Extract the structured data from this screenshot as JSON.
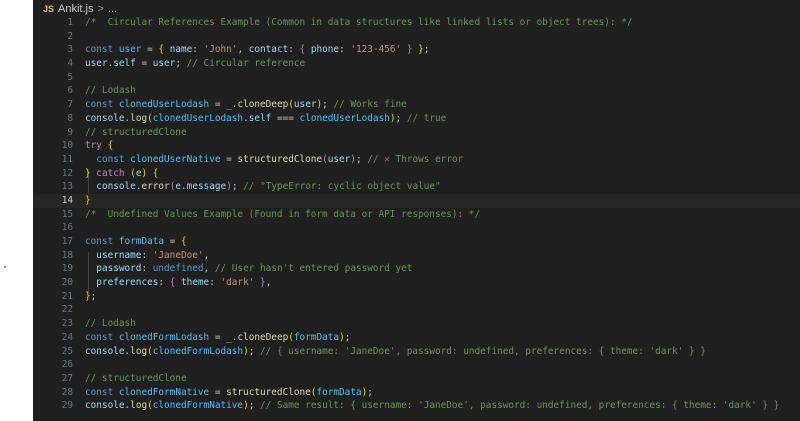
{
  "breadcrumb": {
    "badge": "JS",
    "file": "Ankit.js",
    "sep": ">",
    "rest": "..."
  },
  "lines": [
    {
      "n": "1",
      "t": [
        [
          "cmt",
          "/*  Circular References Example (Common in data structures like linked lists or object trees): */"
        ]
      ]
    },
    {
      "n": "2",
      "t": []
    },
    {
      "n": "3",
      "t": [
        [
          "kw",
          "const "
        ],
        [
          "var",
          "user"
        ],
        [
          "txt",
          " = "
        ],
        [
          "b1",
          "{ "
        ],
        [
          "prop",
          "name"
        ],
        [
          "txt",
          ": "
        ],
        [
          "str",
          "'John'"
        ],
        [
          "txt",
          ", "
        ],
        [
          "prop",
          "contact"
        ],
        [
          "txt",
          ": "
        ],
        [
          "b2",
          "{ "
        ],
        [
          "prop",
          "phone"
        ],
        [
          "txt",
          ": "
        ],
        [
          "str",
          "'123-456'"
        ],
        [
          "b2",
          " }"
        ],
        [
          "b1",
          " }"
        ],
        [
          "txt",
          ";"
        ]
      ]
    },
    {
      "n": "4",
      "t": [
        [
          "prop",
          "user"
        ],
        [
          "txt",
          "."
        ],
        [
          "prop",
          "self"
        ],
        [
          "txt",
          " = "
        ],
        [
          "prop",
          "user"
        ],
        [
          "txt",
          "; "
        ],
        [
          "cmt",
          "// Circular reference"
        ]
      ]
    },
    {
      "n": "5",
      "t": []
    },
    {
      "n": "6",
      "t": [
        [
          "cmt",
          "// Lodash"
        ]
      ]
    },
    {
      "n": "7",
      "t": [
        [
          "kw",
          "const "
        ],
        [
          "var",
          "clonedUserLodash"
        ],
        [
          "txt",
          " = "
        ],
        [
          "prop",
          "_"
        ],
        [
          "txt",
          "."
        ],
        [
          "fn",
          "cloneDeep"
        ],
        [
          "b1",
          "("
        ],
        [
          "prop",
          "user"
        ],
        [
          "b1",
          ")"
        ],
        [
          "txt",
          "; "
        ],
        [
          "cmt",
          "// Works fine"
        ]
      ]
    },
    {
      "n": "8",
      "t": [
        [
          "prop",
          "console"
        ],
        [
          "txt",
          "."
        ],
        [
          "fn",
          "log"
        ],
        [
          "b1",
          "("
        ],
        [
          "var",
          "clonedUserLodash"
        ],
        [
          "txt",
          "."
        ],
        [
          "prop",
          "self"
        ],
        [
          "txt",
          " === "
        ],
        [
          "var",
          "clonedUserLodash"
        ],
        [
          "b1",
          ")"
        ],
        [
          "txt",
          "; "
        ],
        [
          "cmt",
          "// true"
        ]
      ]
    },
    {
      "n": "9",
      "t": [
        [
          "cmt",
          "// structuredClone"
        ]
      ]
    },
    {
      "n": "10",
      "t": [
        [
          "ctl",
          "try "
        ],
        [
          "b1",
          "{"
        ]
      ]
    },
    {
      "n": "11",
      "t": [
        [
          "txt",
          "  "
        ],
        [
          "kw",
          "const "
        ],
        [
          "var",
          "clonedUserNative"
        ],
        [
          "txt",
          " = "
        ],
        [
          "fn",
          "structuredClone"
        ],
        [
          "b2",
          "("
        ],
        [
          "prop",
          "user"
        ],
        [
          "b2",
          ")"
        ],
        [
          "txt",
          "; "
        ],
        [
          "cmt",
          "// "
        ],
        [
          "xmark",
          "✕"
        ],
        [
          "cmt",
          " Throws error"
        ]
      ]
    },
    {
      "n": "12",
      "t": [
        [
          "b1",
          "}"
        ],
        [
          "ctl",
          " catch "
        ],
        [
          "b1",
          "("
        ],
        [
          "prop",
          "e"
        ],
        [
          "b1",
          ")"
        ],
        [
          "txt",
          " "
        ],
        [
          "b1",
          "{"
        ]
      ]
    },
    {
      "n": "13",
      "t": [
        [
          "txt",
          "  "
        ],
        [
          "prop",
          "console"
        ],
        [
          "txt",
          "."
        ],
        [
          "fn",
          "error"
        ],
        [
          "b2",
          "("
        ],
        [
          "prop",
          "e"
        ],
        [
          "txt",
          "."
        ],
        [
          "prop",
          "message"
        ],
        [
          "b2",
          ")"
        ],
        [
          "txt",
          "; "
        ],
        [
          "cmt",
          "// \"TypeError: cyclic object value\""
        ]
      ]
    },
    {
      "n": "14",
      "t": [
        [
          "b1",
          "}"
        ]
      ],
      "active": true
    },
    {
      "n": "15",
      "t": [
        [
          "cmt",
          "/*  Undefined Values Example (Found in form data or API responses): */"
        ]
      ]
    },
    {
      "n": "16",
      "t": []
    },
    {
      "n": "17",
      "t": [
        [
          "kw",
          "const "
        ],
        [
          "var",
          "formData"
        ],
        [
          "txt",
          " = "
        ],
        [
          "b1",
          "{"
        ]
      ]
    },
    {
      "n": "18",
      "t": [
        [
          "txt",
          "  "
        ],
        [
          "prop",
          "username"
        ],
        [
          "txt",
          ": "
        ],
        [
          "str",
          "'JaneDoe'"
        ],
        [
          "txt",
          ","
        ]
      ]
    },
    {
      "n": "19",
      "t": [
        [
          "txt",
          "  "
        ],
        [
          "prop",
          "password"
        ],
        [
          "txt",
          ": "
        ],
        [
          "kw",
          "undefined"
        ],
        [
          "txt",
          ", "
        ],
        [
          "cmt",
          "// User hasn't entered password yet"
        ]
      ]
    },
    {
      "n": "20",
      "t": [
        [
          "txt",
          "  "
        ],
        [
          "prop",
          "preferences"
        ],
        [
          "txt",
          ": "
        ],
        [
          "b2",
          "{ "
        ],
        [
          "prop",
          "theme"
        ],
        [
          "txt",
          ": "
        ],
        [
          "str",
          "'dark'"
        ],
        [
          "b2",
          " }"
        ],
        [
          "txt",
          ","
        ]
      ]
    },
    {
      "n": "21",
      "t": [
        [
          "b1",
          "}"
        ],
        [
          "txt",
          ";"
        ]
      ]
    },
    {
      "n": "22",
      "t": []
    },
    {
      "n": "23",
      "t": [
        [
          "cmt",
          "// Lodash"
        ]
      ]
    },
    {
      "n": "24",
      "t": [
        [
          "kw",
          "const "
        ],
        [
          "var",
          "clonedFormLodash"
        ],
        [
          "txt",
          " = "
        ],
        [
          "prop",
          "_"
        ],
        [
          "txt",
          "."
        ],
        [
          "fn",
          "cloneDeep"
        ],
        [
          "b1",
          "("
        ],
        [
          "var",
          "formData"
        ],
        [
          "b1",
          ")"
        ],
        [
          "txt",
          ";"
        ]
      ]
    },
    {
      "n": "25",
      "t": [
        [
          "prop",
          "console"
        ],
        [
          "txt",
          "."
        ],
        [
          "fn",
          "log"
        ],
        [
          "b1",
          "("
        ],
        [
          "var",
          "clonedFormLodash"
        ],
        [
          "b1",
          ")"
        ],
        [
          "txt",
          "; "
        ],
        [
          "cmt",
          "// { username: 'JaneDoe', password: undefined, preferences: { theme: 'dark' } }"
        ]
      ]
    },
    {
      "n": "26",
      "t": []
    },
    {
      "n": "27",
      "t": [
        [
          "cmt",
          "// structuredClone"
        ]
      ]
    },
    {
      "n": "28",
      "t": [
        [
          "kw",
          "const "
        ],
        [
          "var",
          "clonedFormNative"
        ],
        [
          "txt",
          " = "
        ],
        [
          "fn",
          "structuredClone"
        ],
        [
          "b1",
          "("
        ],
        [
          "var",
          "formData"
        ],
        [
          "b1",
          ")"
        ],
        [
          "txt",
          ";"
        ]
      ]
    },
    {
      "n": "29",
      "t": [
        [
          "prop",
          "console"
        ],
        [
          "txt",
          "."
        ],
        [
          "fn",
          "log"
        ],
        [
          "b1",
          "("
        ],
        [
          "var",
          "clonedFormNative"
        ],
        [
          "b1",
          ")"
        ],
        [
          "txt",
          "; "
        ],
        [
          "cmt",
          "// Same result: { username: 'JaneDoe', password: undefined, preferences: { theme: 'dark' } }"
        ]
      ]
    }
  ]
}
